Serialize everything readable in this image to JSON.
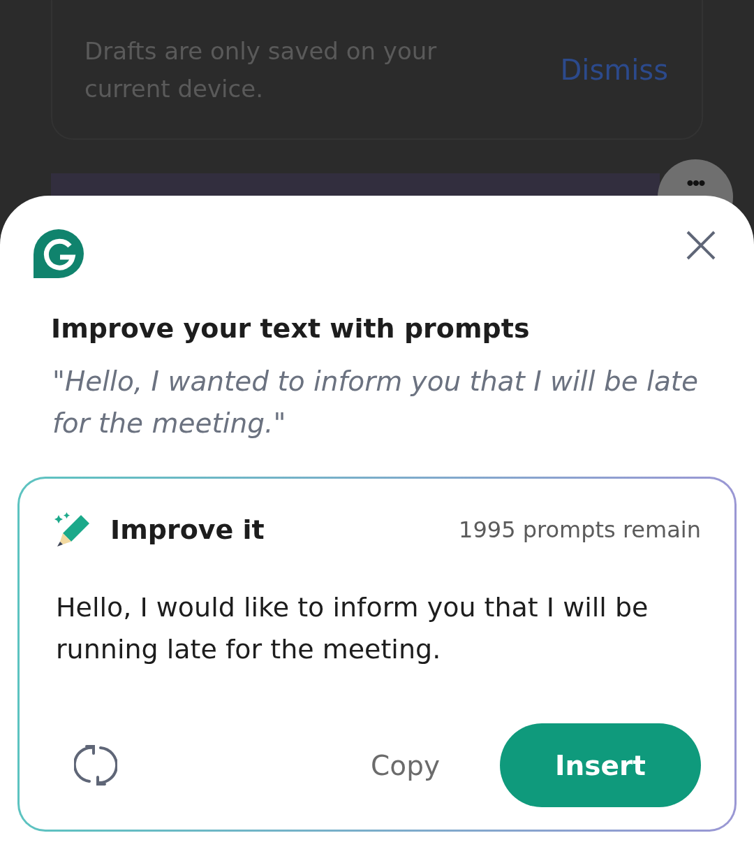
{
  "notice": {
    "text": "Drafts are only saved on your current device.",
    "action": "Dismiss"
  },
  "more_button": {
    "label": "•••"
  },
  "sheet": {
    "title": "Improve your text with prompts",
    "quote": "\"Hello, I wanted to inform you that I will be late for the meeting.\"",
    "result": {
      "heading": "Improve it",
      "remaining": "1995 prompts remain",
      "text": "Hello, I would like to inform you that I will be running late for the meeting.",
      "copy": "Copy",
      "insert": "Insert"
    }
  }
}
